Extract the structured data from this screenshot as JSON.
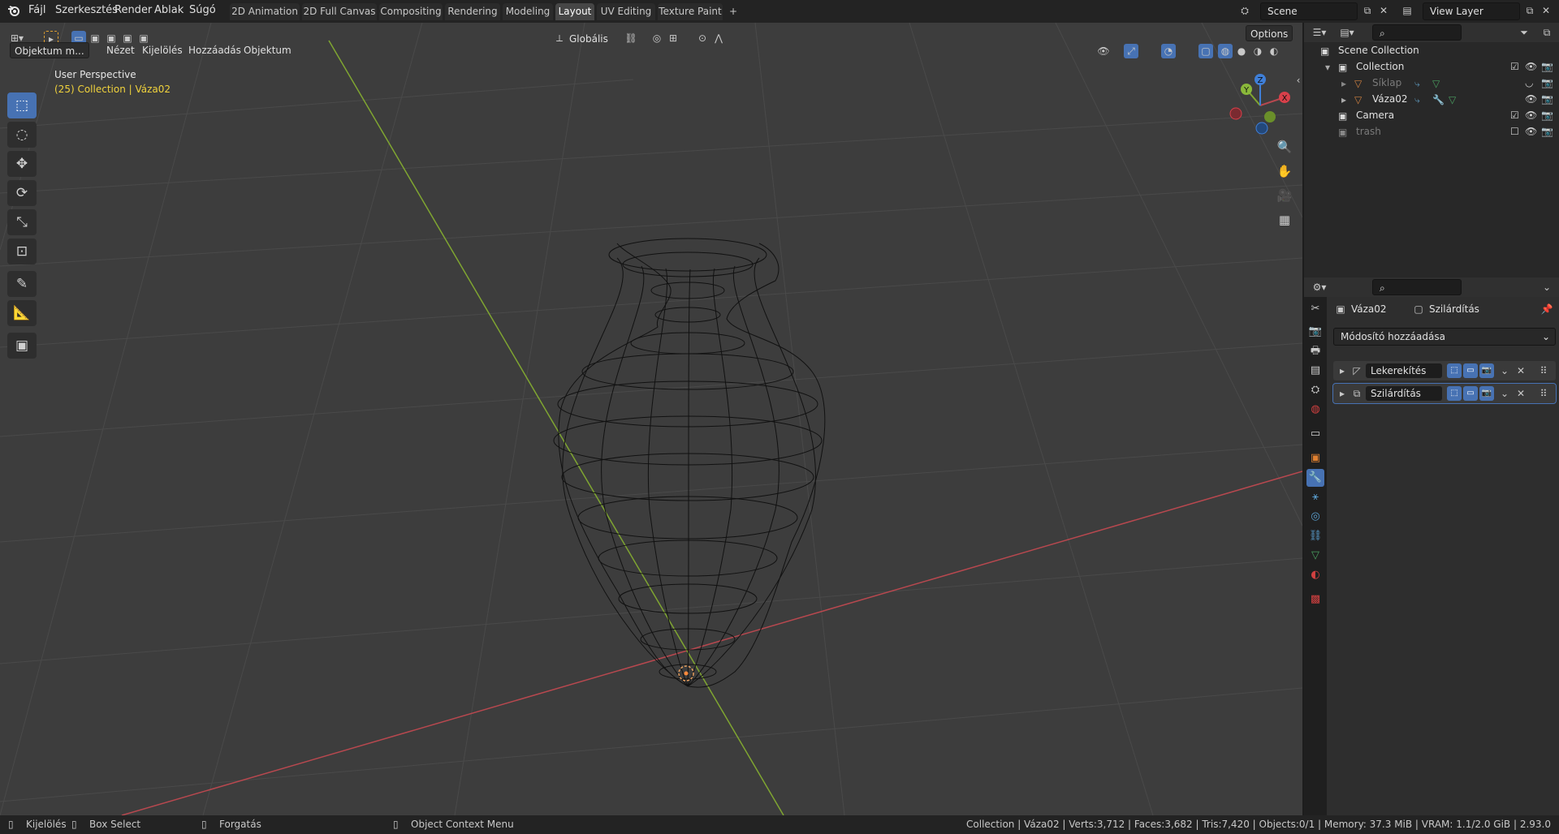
{
  "menu": [
    "Fájl",
    "Szerkesztés",
    "Render",
    "Ablak",
    "Súgó"
  ],
  "workspace_tabs": [
    {
      "label": "2D Animation",
      "active": false
    },
    {
      "label": "2D Full Canvas",
      "active": false
    },
    {
      "label": "Compositing",
      "active": false
    },
    {
      "label": "Rendering",
      "active": false
    },
    {
      "label": "Modeling",
      "active": false
    },
    {
      "label": "Layout",
      "active": true
    },
    {
      "label": "UV Editing",
      "active": false
    },
    {
      "label": "Texture Paint",
      "active": false
    }
  ],
  "add_workspace_icon": "+",
  "scene": {
    "value": "Scene"
  },
  "view_layer": {
    "value": "View Layer"
  },
  "viewport_header": {
    "mode": "Objektum m...",
    "menus": [
      "Nézet",
      "Kijelölés",
      "Hozzáadás",
      "Objektum"
    ],
    "orientation": "Globális",
    "options": "Options"
  },
  "overlay": {
    "perspective": "User Perspective",
    "collection_info": "(25) Collection | Váza02"
  },
  "gizmo_axes": {
    "x": "X",
    "y": "Y",
    "z": "Z"
  },
  "colors": {
    "viewport_bg": "#3d3d3d",
    "x_axis": "#b8484f",
    "y_axis": "#7fa531",
    "accent": "#4772b3",
    "overlay_text": "#f0d23c",
    "wire": "#111111"
  },
  "outliner": {
    "search_placeholder": "",
    "root": "Scene Collection",
    "items": [
      {
        "label": "Collection",
        "level": 1,
        "icon": "collection-icon",
        "dim": false
      },
      {
        "label": "Síklap",
        "level": 2,
        "icon": "mesh-icon",
        "dim": true
      },
      {
        "label": "Váza02",
        "level": 2,
        "icon": "mesh-icon",
        "dim": false
      },
      {
        "label": "Camera",
        "level": 1,
        "icon": "collection-icon",
        "dim": false
      },
      {
        "label": "trash",
        "level": 1,
        "icon": "collection-icon",
        "dim": true
      }
    ]
  },
  "properties": {
    "object_name": "Váza02",
    "modifier_context": "Szilárdítás",
    "add_modifier": "Módosító hozzáadása",
    "modifiers": [
      {
        "name": "Lekerekítés",
        "icon": "bevel-icon",
        "selected": false
      },
      {
        "name": "Szilárdítás",
        "icon": "solidify-icon",
        "selected": true
      }
    ]
  },
  "statusbar": {
    "select": "Kijelölés",
    "box_select": "Box Select",
    "rotate": "Forgatás",
    "context_menu": "Object Context Menu",
    "stats": "Collection | Váza02 | Verts:3,712 | Faces:3,682 | Tris:7,420 | Objects:0/1 | Memory: 37.3 MiB | VRAM: 1.1/2.0 GiB | 2.93.0"
  }
}
